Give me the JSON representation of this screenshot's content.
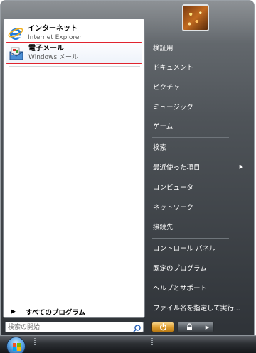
{
  "left": {
    "pinned": [
      {
        "name": "インターネット",
        "sub": "Internet Explorer"
      },
      {
        "name": "電子メール",
        "sub": "Windows メール"
      }
    ],
    "all_programs": "すべてのプログラム",
    "search_placeholder": "検索の開始"
  },
  "right": {
    "items": [
      "検証用",
      "ドキュメント",
      "ピクチャ",
      "ミュージック",
      "ゲーム",
      "検索",
      "最近使った項目",
      "コンピュータ",
      "ネットワーク",
      "接続先",
      "コントロール パネル",
      "既定のプログラム",
      "ヘルプとサポート",
      "ファイル名を指定して実行..."
    ]
  },
  "colors": {
    "selection_border": "#e0242f",
    "power_button": "#e0a032"
  },
  "icons": {
    "ie": "internet-explorer-icon",
    "mail": "windows-mail-icon",
    "search": "magnifier-icon",
    "power": "power-icon",
    "lock": "lock-icon",
    "start": "windows-orb-icon"
  }
}
